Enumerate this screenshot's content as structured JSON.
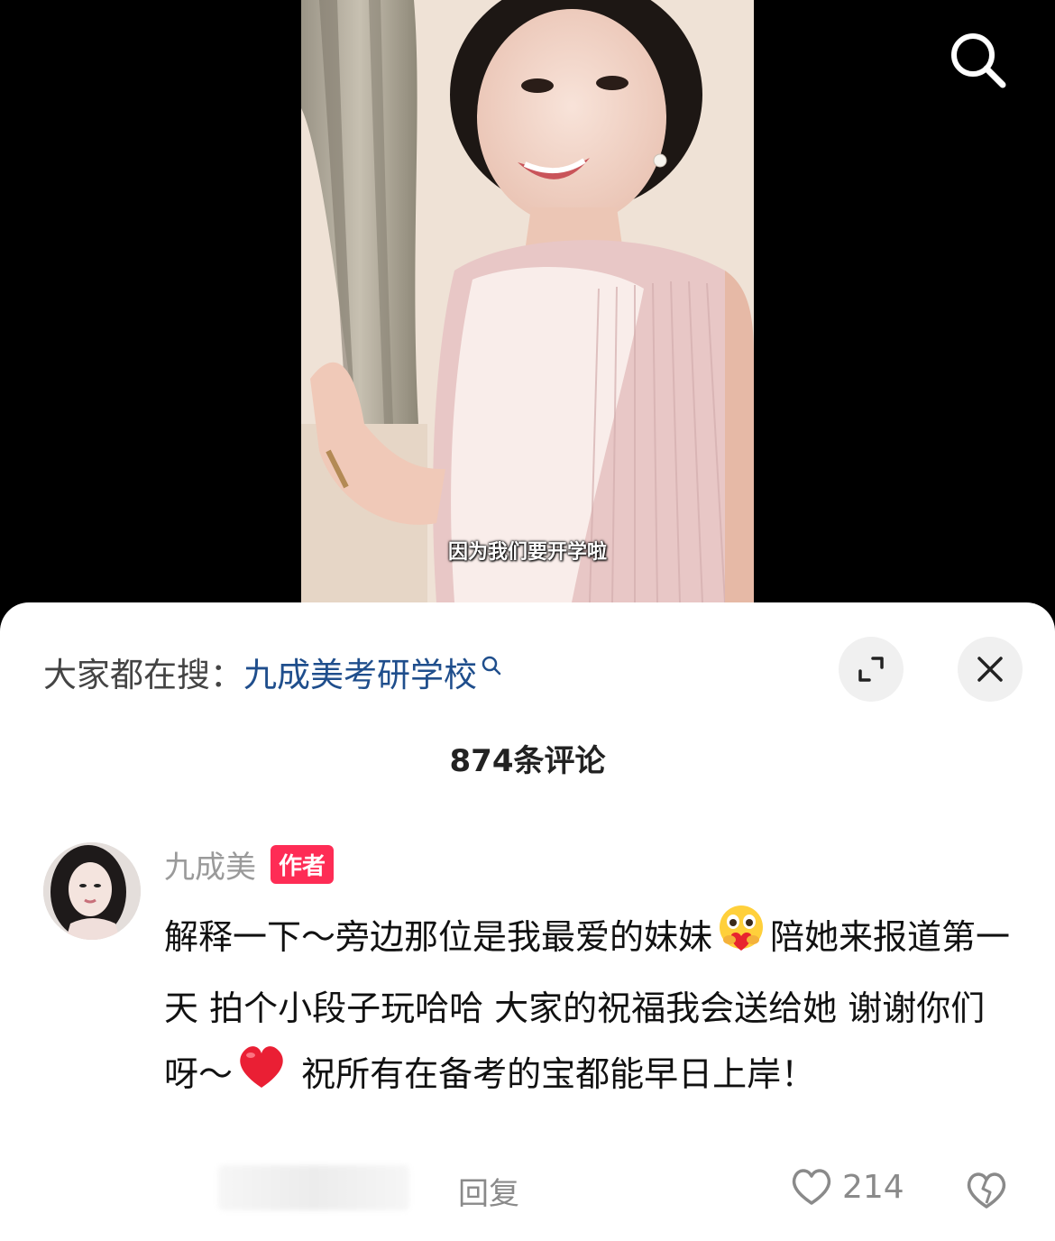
{
  "video": {
    "subtitle": "因为我们要开学啦"
  },
  "header_icons": {
    "search": "search-icon"
  },
  "search_hint": {
    "prefix": "大家都在搜：",
    "keyword": "九成美考研学校",
    "keyword_icon": "small-search-icon"
  },
  "sheet_controls": {
    "expand_icon": "expand-icon",
    "close_icon": "close-icon"
  },
  "comments_header": {
    "count_label": "874条评论"
  },
  "comment": {
    "author": "九成美",
    "badge": "作者",
    "text_part1": "解释一下～旁边那位是我最爱的妹妹",
    "emoji1": "hugging-heart-emoji",
    "text_part2": "陪她来报道第一天 拍个小段子玩哈哈 大家的祝福我会送给她 谢谢你们呀～",
    "emoji2": "red-heart-emoji",
    "text_part3": " 祝所有在备考的宝都能早日上岸！",
    "reply_label": "回复",
    "like_count": "214"
  },
  "colors": {
    "keyword": "#1f4e8c",
    "badge": "#fe2c55",
    "muted_text": "#8a8a8a"
  }
}
